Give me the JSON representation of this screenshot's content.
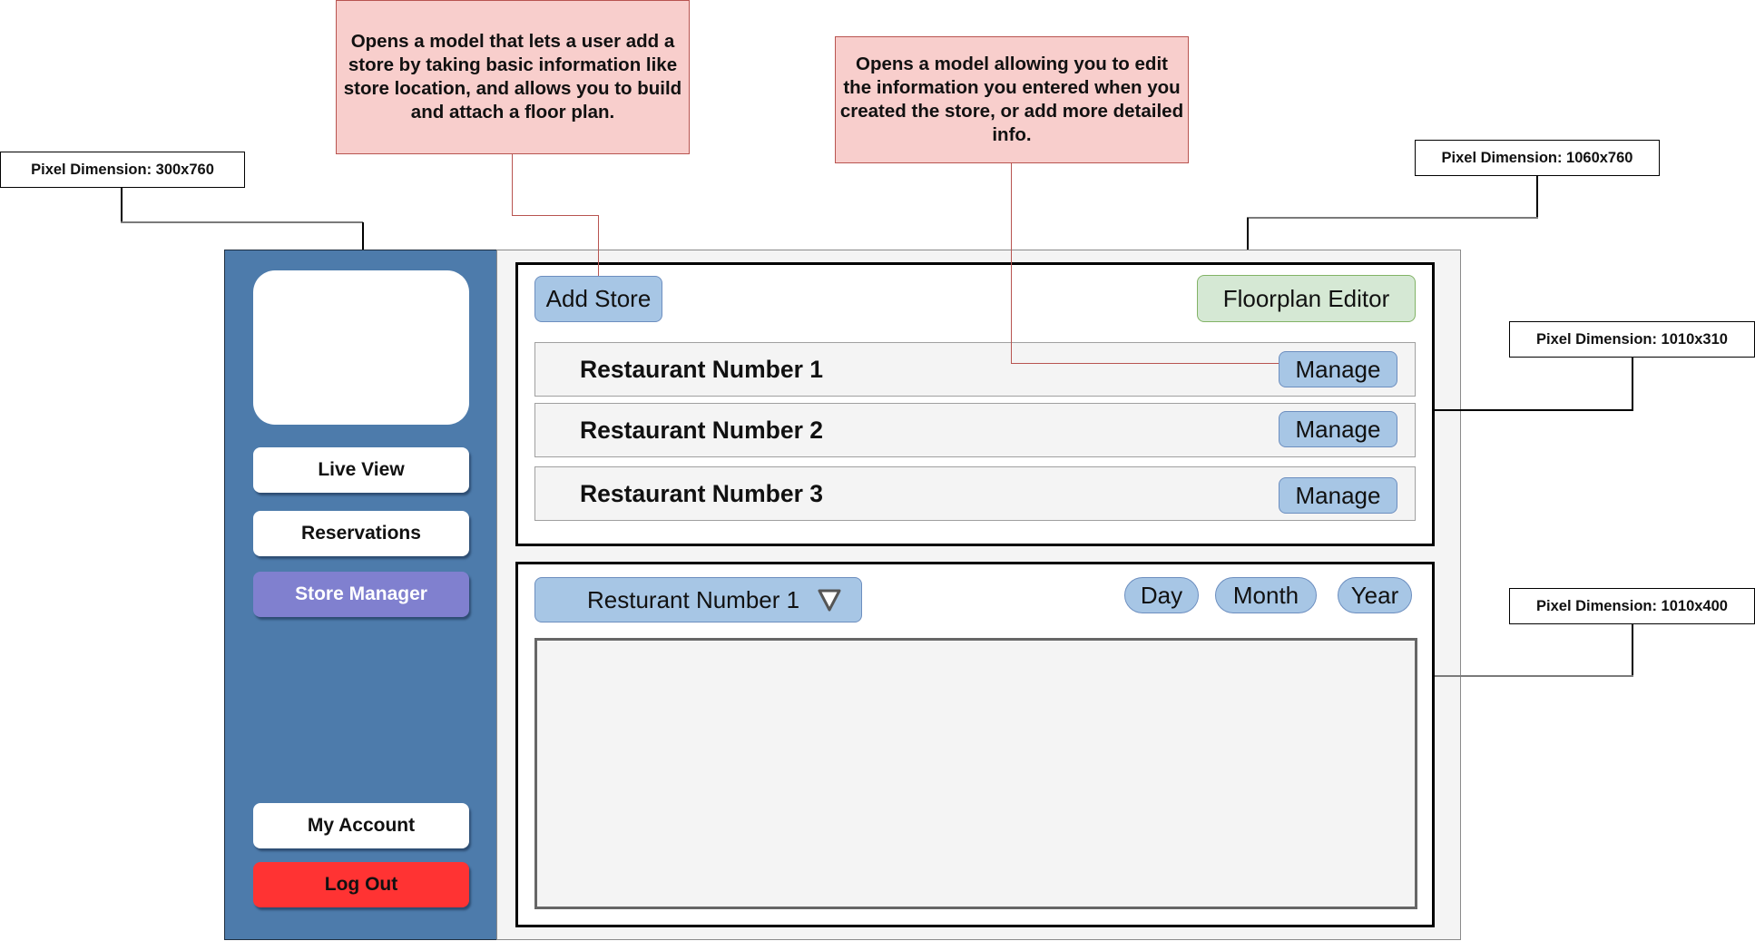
{
  "annotations": {
    "add_store_note": "Opens a model that lets a user add a store by taking basic information like store location, and allows you to build and attach a floor plan.",
    "manage_note": "Opens a model allowing you to edit the information you entered when you created the store, or add more detailed info.",
    "sidebar_dimension": "Pixel Dimension: 300x760",
    "main_dimension": "Pixel Dimension: 1060x760",
    "stores_panel_dimension": "Pixel Dimension: 1010x310",
    "analytics_panel_dimension": "Pixel Dimension: 1010x400"
  },
  "sidebar": {
    "logo_icon": "logo-placeholder",
    "items": [
      {
        "label": "Live View",
        "active": false
      },
      {
        "label": "Reservations",
        "active": false
      },
      {
        "label": "Store Manager",
        "active": true
      }
    ],
    "account_label": "My Account",
    "logout_label": "Log Out"
  },
  "stores_panel": {
    "add_store_label": "Add Store",
    "floorplan_editor_label": "Floorplan Editor",
    "stores": [
      {
        "name": "Restaurant Number 1",
        "action": "Manage"
      },
      {
        "name": "Restaurant Number 2",
        "action": "Manage"
      },
      {
        "name": "Restaurant Number 3",
        "action": "Manage"
      }
    ]
  },
  "analytics_panel": {
    "store_select": {
      "selected": "Resturant Number 1",
      "icon": "triangle-down-icon"
    },
    "ranges": [
      "Day",
      "Month",
      "Year"
    ]
  },
  "colors": {
    "sidebar": "#4d7bab",
    "active_nav": "#8080cf",
    "logout": "#ff3333",
    "primary_button": "#a7c6e5",
    "floorplan_button": "#d5e8d4",
    "note_fill": "#f8cecc"
  }
}
